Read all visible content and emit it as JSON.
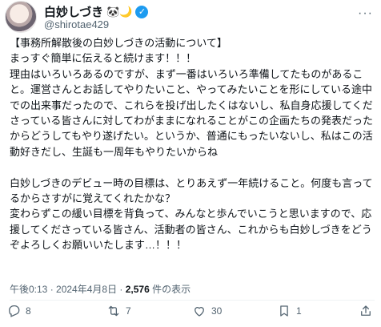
{
  "tweet": {
    "display_name": "白妙しづき",
    "name_emojis": "🐼🌙",
    "handle": "@shirotae429",
    "more": "···",
    "title": "【事務所解散後の白妙しづきの活動について】",
    "paragraphs": [
      "まっすぐ簡単に伝えると続けます！！！",
      "理由はいろいろあるのですが、まず一番はいろいろ準備してたものがあること。運営さんとお話してやりたいこと、やってみたいことを形にしている途中での出来事だったので、これらを投げ出したくはないし、私自身応援してくださっている皆さんに対してわがままになれることがこの企画たちの発表だったからどうしてもやり遂げたい。というか、普通にもったいないし、私はこの活動好きだし、生誕も一周年もやりたいからね",
      "",
      "白妙しづきのデビュー時の目標は、とりあえず一年続けること。何度も言ってるからさすがに覚えてくれたかな？",
      "変わらずこの緩い目標を背負って、みんなと歩んでいこうと思いますので、応援してくださっている皆さん、活動者の皆さん、これからも白妙しづきをどうぞよろしくお願いいたします…！！！"
    ],
    "timestamp": "午後0:13 · 2024年4月8日 · ",
    "views_count": "2,576",
    "views_label": " 件の表示"
  },
  "actions": {
    "reply_count": "8",
    "retweet_count": "7",
    "like_count": "30",
    "bookmark_count": "1"
  },
  "colors": {
    "accent": "#1d9bf0",
    "muted": "#536471",
    "text": "#0f1419"
  }
}
